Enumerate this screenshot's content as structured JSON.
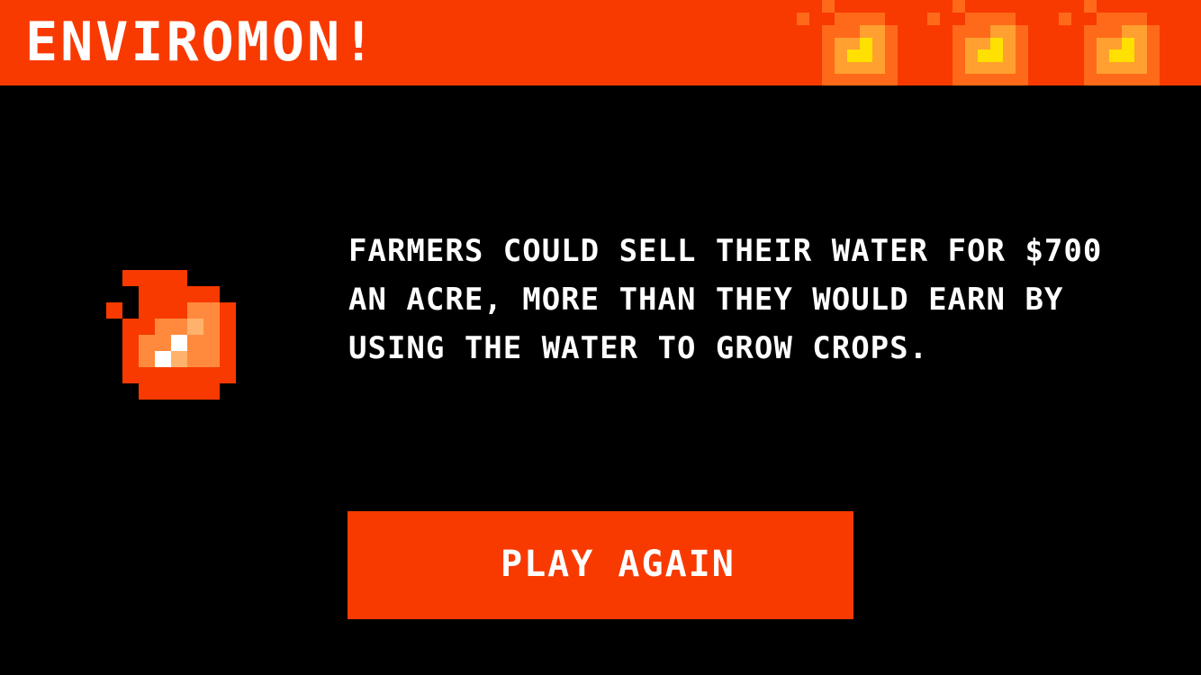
{
  "header": {
    "title": "ENVIROMON!",
    "background_color": "#f83a00",
    "decorations": [
      "fire-icon",
      "fire-icon",
      "fire-icon"
    ]
  },
  "main": {
    "icon": "fire-icon",
    "message": "FARMERS COULD SELL THEIR WATER FOR $700 AN ACRE, MORE THAN THEY WOULD EARN BY USING THE WATER TO GROW CROPS."
  },
  "actions": {
    "play_again_label": "PLAY AGAIN",
    "button_color": "#f83a00"
  },
  "colors": {
    "background": "#000000",
    "fire_dark": "#f83a00",
    "fire_mid": "#ff8a3d",
    "fire_light": "#ffb26b",
    "fire_core": "#ffe000",
    "highlight": "#ffffff"
  }
}
